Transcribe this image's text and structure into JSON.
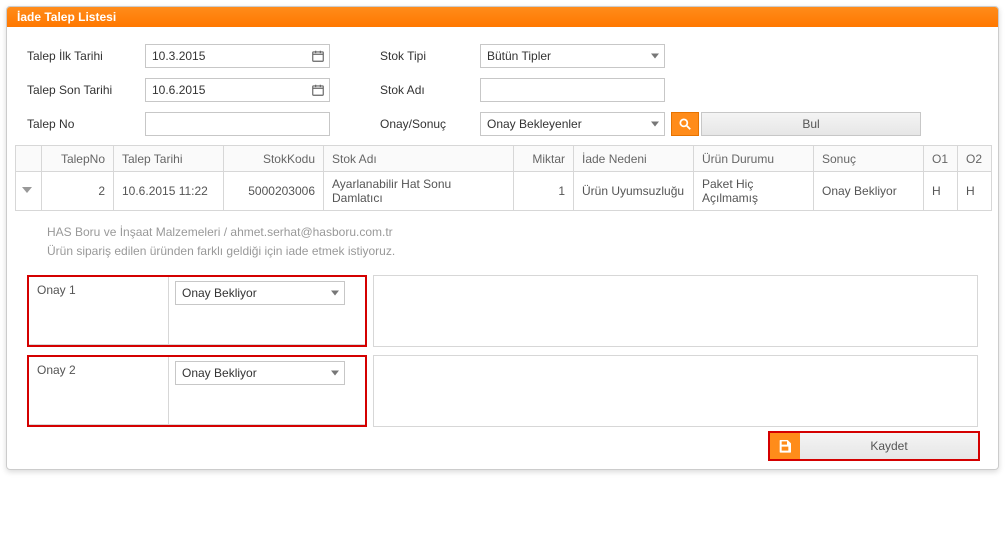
{
  "header": {
    "title": "İade Talep Listesi"
  },
  "filters": {
    "labels": {
      "talep_ilk_tarihi": "Talep İlk Tarihi",
      "talep_son_tarihi": "Talep Son Tarihi",
      "talep_no": "Talep No",
      "stok_tipi": "Stok Tipi",
      "stok_adi": "Stok Adı",
      "onay_sonuc": "Onay/Sonuç"
    },
    "values": {
      "talep_ilk_tarihi": "10.3.2015",
      "talep_son_tarihi": "10.6.2015",
      "talep_no": "",
      "stok_tipi_selected": "Bütün Tipler",
      "stok_adi": "",
      "onay_sonuc_selected": "Onay Bekleyenler"
    },
    "buttons": {
      "bul": "Bul"
    }
  },
  "grid": {
    "columns": {
      "talep_no": "TalepNo",
      "talep_tarihi": "Talep Tarihi",
      "stok_kodu": "StokKodu",
      "stok_adi": "Stok Adı",
      "miktar": "Miktar",
      "iade_nedeni": "İade Nedeni",
      "urun_durumu": "Ürün Durumu",
      "sonuc": "Sonuç",
      "o1": "O1",
      "o2": "O2"
    },
    "rows": [
      {
        "talep_no": "2",
        "talep_tarihi": "10.6.2015 11:22",
        "stok_kodu": "5000203006",
        "stok_adi": "Ayarlanabilir Hat Sonu Damlatıcı",
        "miktar": "1",
        "iade_nedeni": "Ürün Uyumsuzluğu",
        "urun_durumu": "Paket Hiç Açılmamış",
        "sonuc": "Onay Bekliyor",
        "o1": "H",
        "o2": "H"
      }
    ]
  },
  "detail": {
    "line1": "HAS Boru ve İnşaat Malzemeleri / ahmet.serhat@hasboru.com.tr",
    "line2": "Ürün sipariş edilen üründen farklı geldiği için iade etmek istiyoruz."
  },
  "approvals": {
    "items": [
      {
        "label": "Onay 1",
        "selected": "Onay Bekliyor"
      },
      {
        "label": "Onay 2",
        "selected": "Onay Bekliyor"
      }
    ]
  },
  "footer": {
    "save_label": "Kaydet"
  }
}
